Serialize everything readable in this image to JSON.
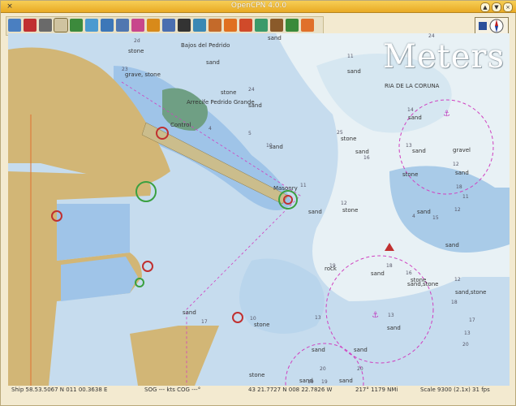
{
  "window": {
    "title": "OpenCPN 4.0.0",
    "close_glyph": "×",
    "controls": [
      "▲",
      "▼",
      "×"
    ]
  },
  "toolbar": {
    "tools": [
      {
        "icon": "route-icon",
        "color": "#4a7fc1"
      },
      {
        "icon": "ship-red-icon",
        "color": "#c03030"
      },
      {
        "icon": "pencil-icon",
        "color": "#6a6a6a"
      },
      {
        "icon": "text-icon",
        "color": "#8c8c8c",
        "active": true
      },
      {
        "icon": "ship-green-icon",
        "color": "#3c8a3c"
      },
      {
        "icon": "zoom-in-icon",
        "color": "#4b9ad0"
      },
      {
        "icon": "zoom-out-icon",
        "color": "#3d77b8"
      },
      {
        "icon": "checkbox-icon",
        "color": "#5077b0"
      },
      {
        "icon": "tide-icon",
        "color": "#c8468c"
      },
      {
        "icon": "folder-icon",
        "color": "#d88a1a"
      },
      {
        "icon": "help-icon",
        "color": "#4a6eb0"
      },
      {
        "icon": "magnifier-icon",
        "color": "#333333"
      },
      {
        "icon": "globe-icon",
        "color": "#3a88b4"
      },
      {
        "icon": "layers-icon",
        "color": "#c46a2a"
      },
      {
        "icon": "flag-icon",
        "color": "#e07020"
      },
      {
        "icon": "bookmark-icon",
        "color": "#d04a2a"
      },
      {
        "icon": "map-icon",
        "color": "#3a9a6a"
      },
      {
        "icon": "clock-icon",
        "color": "#8a5a2a"
      },
      {
        "icon": "download-icon",
        "color": "#3a8a3a"
      },
      {
        "icon": "mob-icon",
        "color": "#e0702a"
      }
    ]
  },
  "chart": {
    "unit_watermark": "Meters",
    "place_labels": [
      {
        "text": "Bajos del Pedrido"
      },
      {
        "text": "RIA DE LA CORUNA"
      },
      {
        "text": "Arrecife Pedrido Grande"
      },
      {
        "text": "Control"
      },
      {
        "text": "Masonry"
      }
    ],
    "seabed_labels": [
      "sand",
      "stone",
      "sand",
      "grave, stone",
      "stone",
      "sand",
      "sand",
      "sand",
      "stone",
      "sand",
      "sand",
      "sand",
      "gravel",
      "sand",
      "stone",
      "sand",
      "stone",
      "sand",
      "rock",
      "stone",
      "sand",
      "sand",
      "sand,stone",
      "sand,stone",
      "sand",
      "stone",
      "sand",
      "sand",
      "sand",
      "sand",
      "sand",
      "stone"
    ],
    "depth_labels": [
      "2d",
      "24",
      "24",
      "23",
      "5",
      "11",
      "4",
      "14",
      "10",
      "16",
      "13",
      "12",
      "18",
      "25",
      "11",
      "15",
      "12",
      "11",
      "4",
      "12",
      "19",
      "18",
      "16",
      "12",
      "18",
      "17",
      "17",
      "10",
      "13",
      "13",
      "13",
      "20",
      "20",
      "19",
      "19",
      "20"
    ]
  },
  "status": {
    "ship": "Ship 58.53.5067 N 011 00.3638 E",
    "sog": "SOG --- kts COG ---°",
    "cursor": "43 21.7727 N  008 22.7826 W",
    "bearing": "217°  1179 NMi",
    "scale": "Scale 9300 (2.1x)  31 fps"
  },
  "colors": {
    "land": "#d2b676",
    "shallow": "#9fc4e8",
    "deep": "#d9eaf0",
    "safety": "#c8dff0",
    "pier": "#cbbd8c",
    "circle_zone": "#d040c0"
  }
}
